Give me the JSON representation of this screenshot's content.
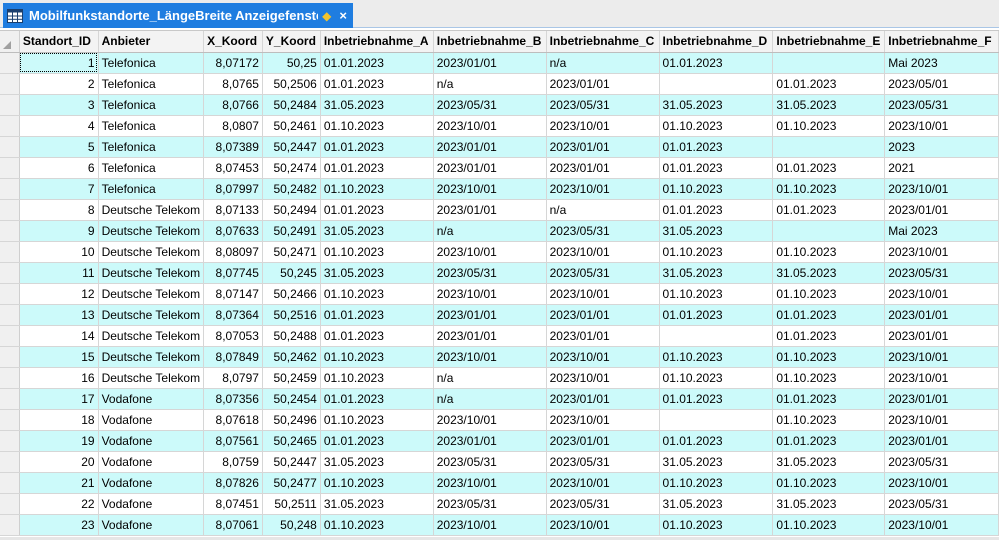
{
  "window": {
    "title": "Mobilfunkstandorte_LängeBreite Anzeigefenster",
    "pin_glyph": "◆",
    "close_glyph": "×",
    "tab_color": "#1f7de0"
  },
  "table": {
    "columns": [
      "Standort_ID",
      "Anbieter",
      "X_Koord",
      "Y_Koord",
      "Inbetriebnahme_A",
      "Inbetriebnahme_B",
      "Inbetriebnahme_C",
      "Inbetriebnahme_D",
      "Inbetriebnahme_E",
      "Inbetriebnahme_F"
    ],
    "rows": [
      [
        "1",
        "Telefonica",
        "8,07172",
        "50,25",
        "01.01.2023",
        "2023/01/01",
        "n/a",
        "01.01.2023",
        "",
        " Mai 2023"
      ],
      [
        "2",
        "Telefonica",
        "8,0765",
        "50,2506",
        "01.01.2023",
        "n/a",
        "2023/01/01",
        "",
        "01.01.2023",
        "2023/05/01"
      ],
      [
        "3",
        "Telefonica",
        "8,0766",
        "50,2484",
        "31.05.2023",
        "2023/05/31",
        "2023/05/31",
        "31.05.2023",
        "31.05.2023",
        "2023/05/31"
      ],
      [
        "4",
        "Telefonica",
        "8,0807",
        "50,2461",
        "01.10.2023",
        "2023/10/01",
        "2023/10/01",
        "01.10.2023",
        "01.10.2023",
        "2023/10/01"
      ],
      [
        "5",
        "Telefonica",
        "8,07389",
        "50,2447",
        "01.01.2023",
        "2023/01/01",
        "2023/01/01",
        "01.01.2023",
        "",
        "2023"
      ],
      [
        "6",
        "Telefonica",
        "8,07453",
        "50,2474",
        "01.01.2023",
        "2023/01/01",
        "2023/01/01",
        "01.01.2023",
        "01.01.2023",
        "2021"
      ],
      [
        "7",
        "Telefonica",
        "8,07997",
        "50,2482",
        "01.10.2023",
        "2023/10/01",
        "2023/10/01",
        "01.10.2023",
        "01.10.2023",
        "2023/10/01"
      ],
      [
        "8",
        "Deutsche Telekom",
        "8,07133",
        "50,2494",
        "01.01.2023",
        "2023/01/01",
        "n/a",
        "01.01.2023",
        "01.01.2023",
        "2023/01/01"
      ],
      [
        "9",
        "Deutsche Telekom",
        "8,07633",
        "50,2491",
        "31.05.2023",
        "n/a",
        "2023/05/31",
        "31.05.2023",
        "",
        " Mai 2023"
      ],
      [
        "10",
        "Deutsche Telekom",
        "8,08097",
        "50,2471",
        "01.10.2023",
        "2023/10/01",
        "2023/10/01",
        "01.10.2023",
        "01.10.2023",
        "2023/10/01"
      ],
      [
        "11",
        "Deutsche Telekom",
        "8,07745",
        "50,245",
        "31.05.2023",
        "2023/05/31",
        "2023/05/31",
        "31.05.2023",
        "31.05.2023",
        "2023/05/31"
      ],
      [
        "12",
        "Deutsche Telekom",
        "8,07147",
        "50,2466",
        "01.10.2023",
        "2023/10/01",
        "2023/10/01",
        "01.10.2023",
        "01.10.2023",
        "2023/10/01"
      ],
      [
        "13",
        "Deutsche Telekom",
        "8,07364",
        "50,2516",
        "01.01.2023",
        "2023/01/01",
        "2023/01/01",
        "01.01.2023",
        "01.01.2023",
        "2023/01/01"
      ],
      [
        "14",
        "Deutsche Telekom",
        "8,07053",
        "50,2488",
        "01.01.2023",
        "2023/01/01",
        "2023/01/01",
        "",
        "01.01.2023",
        "2023/01/01"
      ],
      [
        "15",
        "Deutsche Telekom",
        "8,07849",
        "50,2462",
        "01.10.2023",
        "2023/10/01",
        "2023/10/01",
        "01.10.2023",
        "01.10.2023",
        "2023/10/01"
      ],
      [
        "16",
        "Deutsche Telekom",
        "8,0797",
        "50,2459",
        "01.10.2023",
        "n/a",
        "2023/10/01",
        "01.10.2023",
        "01.10.2023",
        "2023/10/01"
      ],
      [
        "17",
        "Vodafone",
        "8,07356",
        "50,2454",
        "01.01.2023",
        "n/a",
        "2023/01/01",
        "01.01.2023",
        "01.01.2023",
        "2023/01/01"
      ],
      [
        "18",
        "Vodafone",
        "8,07618",
        "50,2496",
        "01.10.2023",
        "2023/10/01",
        "2023/10/01",
        "",
        "01.10.2023",
        "2023/10/01"
      ],
      [
        "19",
        "Vodafone",
        "8,07561",
        "50,2465",
        "01.01.2023",
        "2023/01/01",
        "2023/01/01",
        "01.01.2023",
        "01.01.2023",
        "2023/01/01"
      ],
      [
        "20",
        "Vodafone",
        "8,0759",
        "50,2447",
        "31.05.2023",
        "2023/05/31",
        "2023/05/31",
        "31.05.2023",
        "31.05.2023",
        "2023/05/31"
      ],
      [
        "21",
        "Vodafone",
        "8,07826",
        "50,2477",
        "01.10.2023",
        "2023/10/01",
        "2023/10/01",
        "01.10.2023",
        "01.10.2023",
        "2023/10/01"
      ],
      [
        "22",
        "Vodafone",
        "8,07451",
        "50,2511",
        "31.05.2023",
        "2023/05/31",
        "2023/05/31",
        "31.05.2023",
        "31.05.2023",
        "2023/05/31"
      ],
      [
        "23",
        "Vodafone",
        "8,07061",
        "50,248",
        "01.10.2023",
        "2023/10/01",
        "2023/10/01",
        "01.10.2023",
        "01.10.2023",
        "2023/10/01"
      ]
    ],
    "alt_row_color": "#ccfafa"
  }
}
